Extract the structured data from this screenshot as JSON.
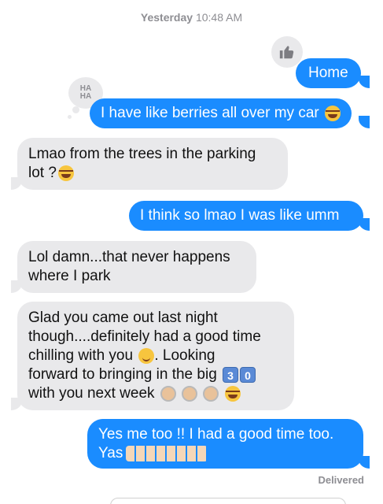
{
  "timestamp": {
    "day": "Yesterday",
    "time": "10:48 AM"
  },
  "messages": [
    {
      "id": "m1",
      "direction": "outgoing",
      "text": "Home",
      "reaction": "thumbs-up-icon"
    },
    {
      "id": "m2",
      "direction": "outgoing",
      "text": "I have like berries all over my car",
      "emoji": [
        "face-with-tears-of-joy-icon"
      ],
      "reaction": "haha"
    },
    {
      "id": "m3",
      "direction": "incoming",
      "line1": "Lmao from the trees in the parking",
      "line2": "lot ?",
      "emoji": [
        "face-with-tears-of-joy-icon"
      ]
    },
    {
      "id": "m4",
      "direction": "outgoing",
      "text": "I think so lmao I was like umm"
    },
    {
      "id": "m5",
      "direction": "incoming",
      "line1": "Lol damn...that never happens",
      "line2": "where I park"
    },
    {
      "id": "m6",
      "direction": "incoming",
      "line1": "Glad you came out last night",
      "line2": "though....definitely had a good time",
      "line3a": "chilling with you",
      "line3b": ". Looking",
      "line4": "forward to bringing in the big",
      "line5": "with you next week",
      "keycaps": [
        "3",
        "0"
      ],
      "emoji": [
        "smiling-face-icon",
        "old-woman-icon",
        "old-woman-icon",
        "old-woman-icon",
        "face-with-tears-of-joy-icon"
      ]
    },
    {
      "id": "m7",
      "direction": "outgoing",
      "line1": "Yes me too !!  I had a good time too.",
      "line2": "Yas",
      "emoji": [
        "raising-hands-icon"
      ]
    }
  ],
  "reactions": {
    "haha_line1": "HA",
    "haha_line2": "HA"
  },
  "status": {
    "delivered": "Delivered"
  },
  "colors": {
    "outgoing_bubble": "#1a8cff",
    "incoming_bubble": "#e9e9eb",
    "meta_text": "#8e8e93"
  }
}
